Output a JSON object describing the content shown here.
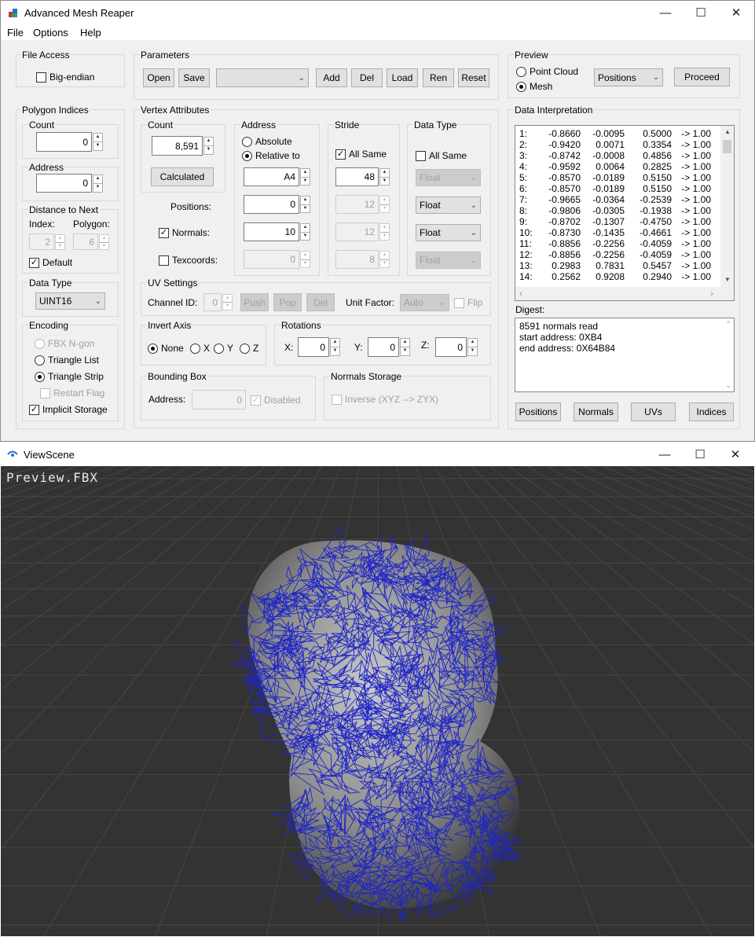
{
  "main_window": {
    "title": "Advanced Mesh Reaper",
    "menu": [
      "File",
      "Options",
      "Help"
    ],
    "controls": {
      "minimize": "—",
      "maximize": "☐",
      "close": "✕"
    }
  },
  "file_access": {
    "label": "File Access",
    "big_endian_label": "Big-endian",
    "big_endian_checked": false
  },
  "parameters": {
    "label": "Parameters",
    "buttons": [
      "Open",
      "Save",
      "Add",
      "Del",
      "Load",
      "Ren",
      "Reset"
    ],
    "preset_value": ""
  },
  "preview": {
    "label": "Preview",
    "point_cloud_label": "Point Cloud",
    "mesh_label": "Mesh",
    "selected_mode": "Mesh",
    "dropdown_value": "Positions",
    "proceed_label": "Proceed"
  },
  "polygon_indices": {
    "label": "Polygon Indices",
    "count_label": "Count",
    "count_value": "0",
    "address_label": "Address",
    "address_value": "0",
    "distance_label": "Distance to Next",
    "index_label": "Index:",
    "index_value": "2",
    "polygon_label": "Polygon:",
    "polygon_value": "6",
    "default_label": "Default",
    "default_checked": true,
    "data_type_label": "Data Type",
    "data_type_value": "UINT16",
    "encoding_label": "Encoding",
    "encoding_options": [
      "FBX N-gon",
      "Triangle List",
      "Triangle Strip"
    ],
    "encoding_selected": "Triangle Strip",
    "restart_flag_label": "Restart Flag",
    "implicit_storage_label": "Implicit Storage",
    "implicit_storage_checked": true
  },
  "vertex_attributes": {
    "label": "Vertex Attributes",
    "count_label": "Count",
    "count_value": "8,591",
    "calculated_label": "Calculated",
    "address_label": "Address",
    "absolute_label": "Absolute",
    "relative_label": "Relative to",
    "address_mode": "Relative to",
    "stride_label": "Stride",
    "all_same_stride_label": "All Same",
    "all_same_stride_checked": true,
    "data_type_label": "Data Type",
    "all_same_type_label": "All Same",
    "all_same_type_checked": false,
    "rows": [
      {
        "label": "",
        "address": "A4",
        "stride": "48",
        "type": "Float",
        "enabled": true,
        "is_base": true
      },
      {
        "label": "Positions:",
        "address": "0",
        "stride": "12",
        "type": "Float",
        "checkable": false,
        "checked": false
      },
      {
        "label": "Normals:",
        "address": "10",
        "stride": "12",
        "type": "Float",
        "checkable": true,
        "checked": true
      },
      {
        "label": "Texcoords:",
        "address": "0",
        "stride": "8",
        "type": "Float",
        "checkable": true,
        "checked": false
      }
    ]
  },
  "uv_settings": {
    "label": "UV Settings",
    "channel_label": "Channel ID:",
    "channel_value": "0",
    "push_label": "Push",
    "pop_label": "Pop",
    "del_label": "Del",
    "unit_factor_label": "Unit Factor:",
    "unit_factor_value": "Auto",
    "flip_label": "Flip"
  },
  "invert_axis": {
    "label": "Invert Axis",
    "options": [
      "None",
      "X",
      "Y",
      "Z"
    ],
    "selected": "None"
  },
  "rotations": {
    "label": "Rotations",
    "x_label": "X:",
    "x_value": "0",
    "y_label": "Y:",
    "y_value": "0",
    "z_label": "Z:",
    "z_value": "0"
  },
  "bounding_box": {
    "label": "Bounding Box",
    "address_label": "Address:",
    "address_value": "0",
    "disabled_label": "Disabled",
    "disabled_checked": true
  },
  "normals_storage": {
    "label": "Normals Storage",
    "inverse_label": "Inverse (XYZ --> ZYX)",
    "inverse_checked": false
  },
  "data_interpretation": {
    "label": "Data Interpretation",
    "rows": [
      [
        "1:",
        "-0.8660",
        "-0.0095",
        "0.5000",
        "-> 1.00"
      ],
      [
        "2:",
        "-0.9420",
        "0.0071",
        "0.3354",
        "-> 1.00"
      ],
      [
        "3:",
        "-0.8742",
        "-0.0008",
        "0.4856",
        "-> 1.00"
      ],
      [
        "4:",
        "-0.9592",
        "0.0064",
        "0.2825",
        "-> 1.00"
      ],
      [
        "5:",
        "-0.8570",
        "-0.0189",
        "0.5150",
        "-> 1.00"
      ],
      [
        "6:",
        "-0.8570",
        "-0.0189",
        "0.5150",
        "-> 1.00"
      ],
      [
        "7:",
        "-0.9665",
        "-0.0364",
        "-0.2539",
        "-> 1.00"
      ],
      [
        "8:",
        "-0.9806",
        "-0.0305",
        "-0.1938",
        "-> 1.00"
      ],
      [
        "9:",
        "-0.8702",
        "-0.1307",
        "-0.4750",
        "-> 1.00"
      ],
      [
        "10:",
        "-0.8730",
        "-0.1435",
        "-0.4661",
        "-> 1.00"
      ],
      [
        "11:",
        "-0.8856",
        "-0.2256",
        "-0.4059",
        "-> 1.00"
      ],
      [
        "12:",
        "-0.8856",
        "-0.2256",
        "-0.4059",
        "-> 1.00"
      ],
      [
        "13:",
        "0.2983",
        "0.7831",
        "0.5457",
        "-> 1.00"
      ],
      [
        "14:",
        "0.2562",
        "0.9208",
        "0.2940",
        "-> 1.00"
      ]
    ]
  },
  "digest": {
    "label": "Digest:",
    "lines": [
      "8591 normals read",
      "start address: 0XB4",
      "end address: 0X64B84"
    ]
  },
  "bottom_buttons": [
    "Positions",
    "Normals",
    "UVs",
    "Indices"
  ],
  "view_scene": {
    "title": "ViewScene",
    "overlay_text": "Preview.FBX",
    "wire_color": "#1e24c8",
    "background": "#333333"
  }
}
